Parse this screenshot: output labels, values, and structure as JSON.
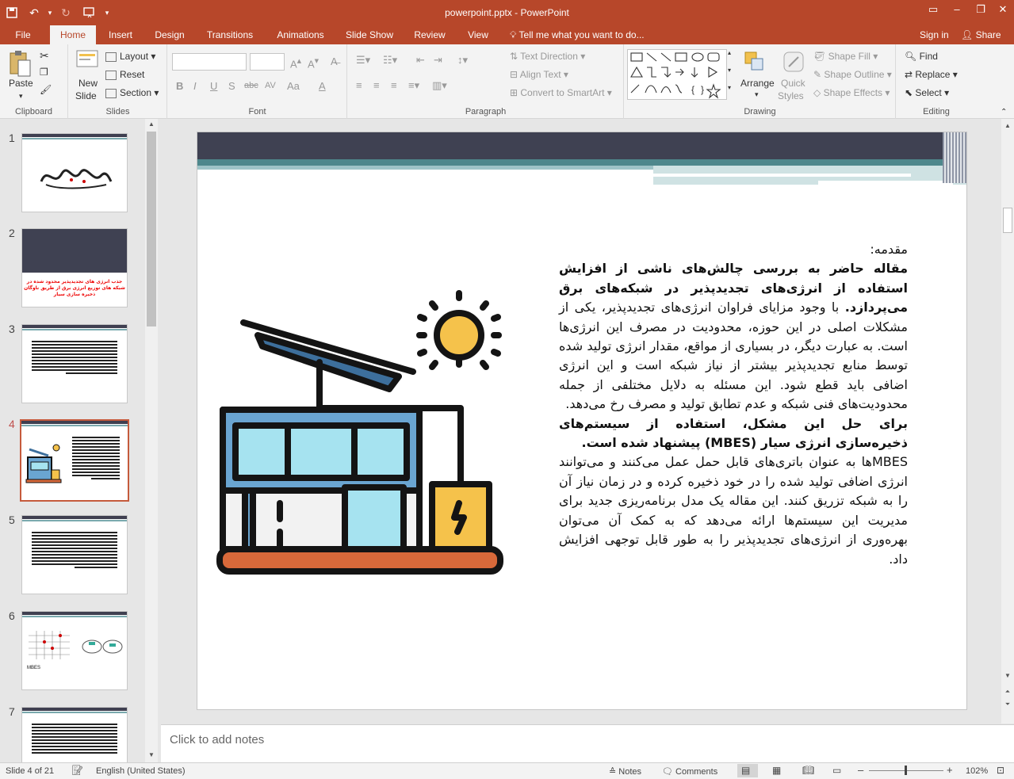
{
  "window": {
    "title": "powerpoint.pptx - PowerPoint",
    "quick_access": [
      "save-icon",
      "undo-icon",
      "redo-icon",
      "start-from-beginning-icon",
      "customize-icon"
    ]
  },
  "tabs": {
    "file": "File",
    "home": "Home",
    "insert": "Insert",
    "design": "Design",
    "transitions": "Transitions",
    "animations": "Animations",
    "slideshow": "Slide Show",
    "review": "Review",
    "view": "View",
    "tellme": "Tell me what you want to do...",
    "signin": "Sign in",
    "share": "Share"
  },
  "ribbon": {
    "clipboard": {
      "label": "Clipboard",
      "paste": "Paste"
    },
    "slides": {
      "label": "Slides",
      "new_slide_1": "New",
      "new_slide_2": "Slide",
      "layout": "Layout",
      "reset": "Reset",
      "section": "Section"
    },
    "font": {
      "label": "Font",
      "bold": "B",
      "italic": "I",
      "underline": "U",
      "strike": "S",
      "abc": "abc",
      "spacing": "AV",
      "case": "Aa",
      "color": "A"
    },
    "paragraph": {
      "label": "Paragraph",
      "text_direction": "Text Direction",
      "align_text": "Align Text",
      "smartart": "Convert to SmartArt"
    },
    "drawing": {
      "label": "Drawing",
      "arrange": "Arrange",
      "quick_styles_1": "Quick",
      "quick_styles_2": "Styles",
      "shape_fill": "Shape Fill",
      "shape_outline": "Shape Outline",
      "shape_effects": "Shape Effects"
    },
    "editing": {
      "label": "Editing",
      "find": "Find",
      "replace": "Replace",
      "select": "Select"
    }
  },
  "thumbnails": [
    {
      "num": "1"
    },
    {
      "num": "2",
      "text": "جذب انرژی های تجدیدپذیر محدود شده در شبکه های توزیع انرژی برق از طریق ناوگان ذخیره سازی سیار"
    },
    {
      "num": "3"
    },
    {
      "num": "4"
    },
    {
      "num": "5"
    },
    {
      "num": "6",
      "caption_left": "MBES",
      "caption_right": ""
    },
    {
      "num": "7"
    }
  ],
  "slide": {
    "heading": "مقدمه:",
    "p1_bold": "مقاله حاضر به بررسی چالش‌های ناشی از افزایش استفاده از انرژی‌های تجدیدپذیر در شبکه‌های برق می‌پردازد.",
    "p1_rest": " با وجود مزایای فراوان انرژی‌های تجدیدپذیر، یکی از مشکلات اصلی در این حوزه، محدودیت در مصرف این انرژی‌ها است. به عبارت دیگر، در بسیاری از مواقع، مقدار انرژی تولید شده توسط منابع تجدیدپذیر بیشتر از نیاز شبکه است و این انرژی اضافی باید قطع شود. این مسئله به دلایل مختلفی از جمله محدودیت‌های فنی شبکه و عدم تطابق تولید و مصرف رخ می‌دهد.",
    "p2_bold": "برای حل این مشکل، استفاده از سیستم‌های ذخیره‌سازی انرژی سیار (MBES) پیشنهاد شده است.",
    "p2_rest": "MBESها به عنوان باتری‌های قابل حمل عمل می‌کنند و می‌توانند انرژی اضافی تولید شده را در خود ذخیره کرده و در زمان نیاز آن را به شبکه تزریق کنند. این مقاله یک مدل برنامه‌ریزی جدید برای مدیریت این سیستم‌ها ارائه می‌دهد که به کمک آن می‌توان بهره‌وری از انرژی‌های تجدیدپذیر را به طور قابل توجهی افزایش داد."
  },
  "notes": {
    "placeholder": "Click to add notes"
  },
  "status": {
    "slide_of": "Slide 4 of 21",
    "language": "English (United States)",
    "notes": "Notes",
    "comments": "Comments",
    "zoom": "102%"
  },
  "colors": {
    "accent": "#b7472a",
    "slide_band": "#3f4152",
    "teal": "#4e878c"
  }
}
